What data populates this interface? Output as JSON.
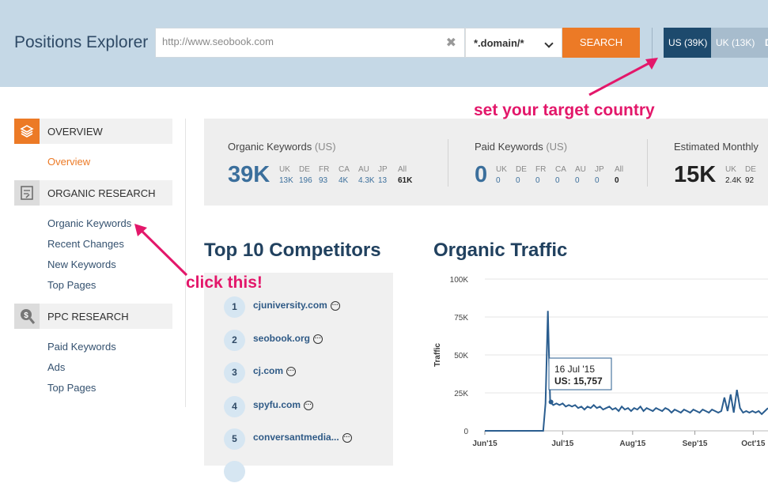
{
  "header": {
    "title": "Positions Explorer",
    "url_placeholder": "http://www.seobook.com",
    "mode": "*.domain/*",
    "search_label": "SEARCH",
    "countries": [
      {
        "label": "US (39K)",
        "selected": true
      },
      {
        "label": "UK (13K)",
        "selected": false
      },
      {
        "label": "D",
        "selected": false
      }
    ]
  },
  "sidebar": {
    "sections": [
      {
        "title": "OVERVIEW",
        "icon": "stack-layers-icon",
        "items": [
          "Overview"
        ],
        "active": "Overview"
      },
      {
        "title": "ORGANIC RESEARCH",
        "icon": "document-chart-icon",
        "items": [
          "Organic Keywords",
          "Recent Changes",
          "New Keywords",
          "Top Pages"
        ]
      },
      {
        "title": "PPC RESEARCH",
        "icon": "dollar-search-icon",
        "items": [
          "Paid Keywords",
          "Ads",
          "Top Pages"
        ]
      }
    ]
  },
  "metrics": [
    {
      "title": "Organic Keywords",
      "paren": "(US)",
      "big": "39K",
      "big_color": "#3b6f9c",
      "breakdown": [
        [
          "UK",
          "13K"
        ],
        [
          "DE",
          "196"
        ],
        [
          "FR",
          "93"
        ],
        [
          "CA",
          "4K"
        ],
        [
          "AU",
          "4.3K"
        ],
        [
          "JP",
          "13"
        ],
        [
          "All",
          "61K"
        ]
      ],
      "value_color": "#3b6f9c"
    },
    {
      "title": "Paid Keywords",
      "paren": "(US)",
      "big": "0",
      "big_color": "#3b6f9c",
      "breakdown": [
        [
          "UK",
          "0"
        ],
        [
          "DE",
          "0"
        ],
        [
          "FR",
          "0"
        ],
        [
          "CA",
          "0"
        ],
        [
          "AU",
          "0"
        ],
        [
          "JP",
          "0"
        ],
        [
          "All",
          "0"
        ]
      ],
      "value_color": "#3b6f9c"
    },
    {
      "title": "Estimated Monthly",
      "paren": "",
      "big": "15K",
      "big_color": "#222222",
      "breakdown": [
        [
          "UK",
          "2.4K"
        ],
        [
          "DE",
          "92"
        ]
      ],
      "value_color": "#222222"
    }
  ],
  "competitors": {
    "title": "Top 10 Competitors",
    "items": [
      {
        "rank": "1",
        "name": "cjuniversity.com"
      },
      {
        "rank": "2",
        "name": "seobook.org"
      },
      {
        "rank": "3",
        "name": "cj.com"
      },
      {
        "rank": "4",
        "name": "spyfu.com"
      },
      {
        "rank": "5",
        "name": "conversantmedia..."
      }
    ]
  },
  "traffic": {
    "title": "Organic Traffic",
    "tooltip_date": "16 Jul '15",
    "tooltip_value": "US: 15,757"
  },
  "annotations": {
    "country": "set your target country",
    "click": "click this!"
  },
  "chart_data": {
    "type": "line",
    "title": "Organic Traffic",
    "xlabel": "",
    "ylabel": "Traffic",
    "ylim": [
      0,
      100000
    ],
    "y_ticks": [
      "0",
      "25K",
      "50K",
      "75K",
      "100K"
    ],
    "x_ticks": [
      "Jun'15",
      "Jul'15",
      "Aug'15",
      "Sep'15",
      "Oct'15"
    ],
    "grid": true,
    "line_color": "#2a5d8f",
    "series": [
      {
        "values": [
          [
            0,
            0
          ],
          [
            12,
            0
          ],
          [
            24,
            0
          ],
          [
            36,
            0
          ],
          [
            48,
            0
          ],
          [
            60,
            0
          ],
          [
            71,
            0
          ],
          [
            75,
            0
          ],
          [
            78,
            18000
          ],
          [
            81,
            79000
          ],
          [
            84,
            19000
          ],
          [
            88,
            17000
          ],
          [
            92,
            18000
          ],
          [
            96,
            17000
          ],
          [
            100,
            18000
          ],
          [
            104,
            16000
          ],
          [
            108,
            17000
          ],
          [
            112,
            16000
          ],
          [
            116,
            17000
          ],
          [
            120,
            15000
          ],
          [
            124,
            16000
          ],
          [
            128,
            14000
          ],
          [
            132,
            16000
          ],
          [
            136,
            15000
          ],
          [
            140,
            17000
          ],
          [
            144,
            15000
          ],
          [
            148,
            16000
          ],
          [
            152,
            14000
          ],
          [
            156,
            15000
          ],
          [
            160,
            16000
          ],
          [
            164,
            14000
          ],
          [
            168,
            15000
          ],
          [
            172,
            13000
          ],
          [
            176,
            16000
          ],
          [
            180,
            14000
          ],
          [
            184,
            15000
          ],
          [
            188,
            13000
          ],
          [
            192,
            15000
          ],
          [
            196,
            14000
          ],
          [
            200,
            16000
          ],
          [
            204,
            13000
          ],
          [
            208,
            15000
          ],
          [
            212,
            14000
          ],
          [
            216,
            13000
          ],
          [
            220,
            15000
          ],
          [
            224,
            14000
          ],
          [
            228,
            13000
          ],
          [
            232,
            15000
          ],
          [
            236,
            14000
          ],
          [
            240,
            12000
          ],
          [
            244,
            14000
          ],
          [
            248,
            13000
          ],
          [
            252,
            12000
          ],
          [
            256,
            14000
          ],
          [
            260,
            13000
          ],
          [
            264,
            12000
          ],
          [
            268,
            14000
          ],
          [
            272,
            13000
          ],
          [
            276,
            12000
          ],
          [
            280,
            14000
          ],
          [
            284,
            13000
          ],
          [
            288,
            12000
          ],
          [
            292,
            14000
          ],
          [
            296,
            13000
          ],
          [
            300,
            12000
          ],
          [
            304,
            13000
          ],
          [
            308,
            22000
          ],
          [
            312,
            13000
          ],
          [
            316,
            24000
          ],
          [
            320,
            12000
          ],
          [
            324,
            27000
          ],
          [
            328,
            15000
          ],
          [
            332,
            12000
          ],
          [
            336,
            13000
          ],
          [
            340,
            12000
          ],
          [
            344,
            13000
          ],
          [
            348,
            12000
          ],
          [
            352,
            13000
          ],
          [
            356,
            11000
          ],
          [
            360,
            13000
          ],
          [
            364,
            15000
          ]
        ]
      }
    ],
    "x_range": [
      0,
      364
    ],
    "x_tick_positions": [
      0,
      100,
      190,
      270,
      345
    ]
  }
}
